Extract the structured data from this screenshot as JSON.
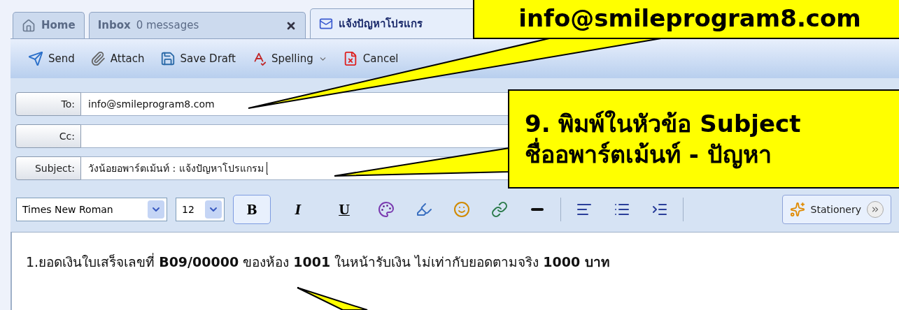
{
  "tabs": [
    {
      "kind": "home",
      "label": "Home",
      "selected": false
    },
    {
      "kind": "inbox",
      "label": "Inbox",
      "count": "0 messages",
      "selected": false
    },
    {
      "kind": "compose",
      "label": "แจ้งปัญหาโปรแกร",
      "selected": true
    }
  ],
  "toolbar": [
    {
      "kind": "send",
      "label": "Send"
    },
    {
      "kind": "attach",
      "label": "Attach"
    },
    {
      "kind": "save",
      "label": "Save Draft"
    },
    {
      "kind": "spelling",
      "label": "Spelling",
      "has_menu": true
    },
    {
      "kind": "cancel",
      "label": "Cancel"
    }
  ],
  "fields": [
    {
      "label": "To:",
      "value": "info@smileprogram8.com",
      "focused": false
    },
    {
      "label": "Cc:",
      "focused": false
    },
    {
      "label": "Subject:",
      "value": "วังน้อยอพาร์ตเม้นท์ : แจ้งปัญหาโปรแกรม",
      "focused": true
    }
  ],
  "format_bar": {
    "font": "Times New Roman",
    "size": "12",
    "style_buttons": [
      {
        "kind": "bold",
        "label": "B",
        "selected": true
      },
      {
        "kind": "italic",
        "label": "I",
        "selected": false
      },
      {
        "kind": "underline",
        "label": "U",
        "selected": false
      }
    ],
    "tools": [
      {
        "kind": "text_color"
      },
      {
        "kind": "highlight"
      },
      {
        "kind": "emoticon"
      },
      {
        "kind": "link"
      },
      {
        "kind": "rule"
      },
      {
        "kind": "separator"
      },
      {
        "kind": "align"
      },
      {
        "kind": "bullets"
      },
      {
        "kind": "indent"
      },
      {
        "kind": "separator"
      }
    ],
    "stationery": "Stationery"
  },
  "body": "1.ยอดเงินใบเสร็จเลขที่ **B09/00000** ของห้อง **1001** ในหน้ารับเงิน ไม่เท่ากับยอดตามจริง **1000 บาท**",
  "callouts": [
    {
      "kind": "email",
      "lines": [
        "info@smileprogram8.com"
      ]
    },
    {
      "kind": "subject",
      "lines": [
        "9. พิมพ์ในหัวข้อ Subject",
        "ชื่ออพาร์ตเม้นท์ - ปัญหา"
      ]
    }
  ]
}
